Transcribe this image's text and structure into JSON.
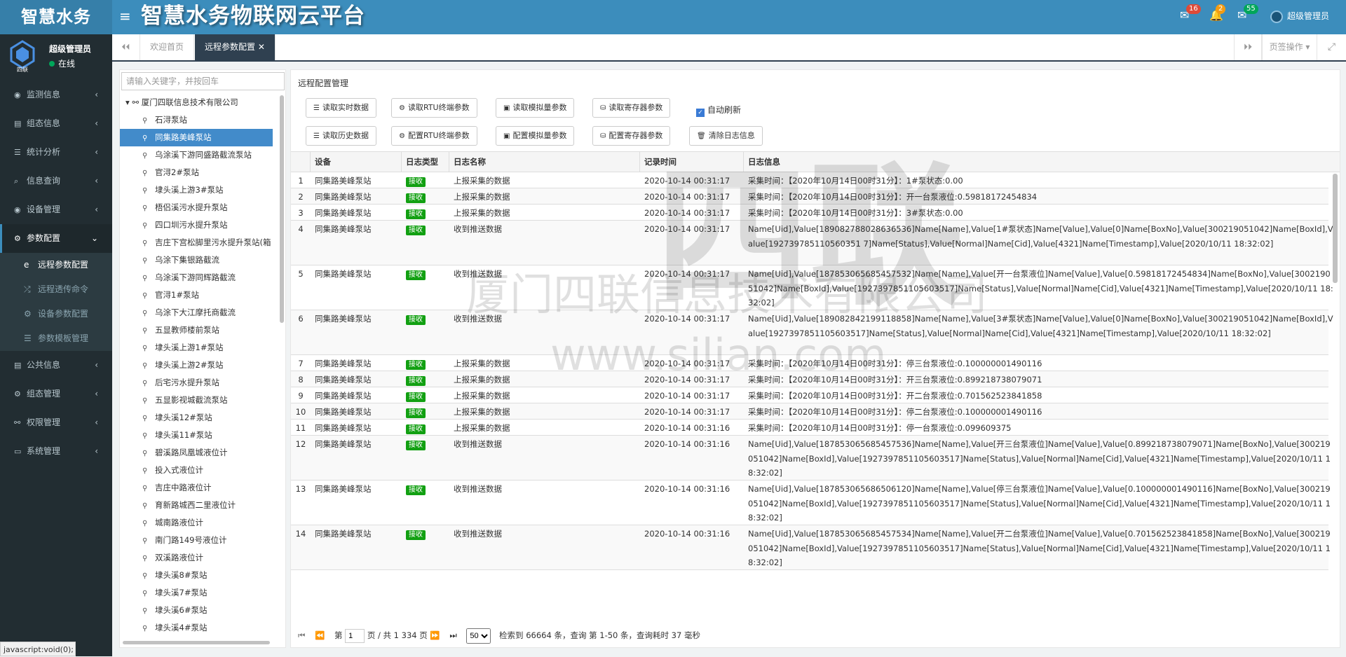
{
  "logo": "智慧水务",
  "system_title": "智慧水务物联网云平台",
  "topbar": {
    "messages_count": "16",
    "notifications_count": "2",
    "tasks_count": "55",
    "user_name": "超级管理员"
  },
  "user_panel": {
    "name": "超级管理员",
    "status": "在线",
    "logo_text": "四联"
  },
  "menu": [
    {
      "label": "监测信息",
      "icon": "dashboard-icon"
    },
    {
      "label": "组态信息",
      "icon": "layout-icon"
    },
    {
      "label": "统计分析",
      "icon": "list-icon"
    },
    {
      "label": "信息查询",
      "icon": "search-icon"
    },
    {
      "label": "设备管理",
      "icon": "dashboard-icon"
    },
    {
      "label": "参数配置",
      "icon": "gears-icon"
    }
  ],
  "submenu": [
    {
      "label": "远程参数配置"
    },
    {
      "label": "远程透传命令"
    },
    {
      "label": "设备参数配置"
    },
    {
      "label": "参数模板管理"
    }
  ],
  "menu2": [
    {
      "label": "公共信息"
    },
    {
      "label": "组态管理"
    },
    {
      "label": "权限管理"
    },
    {
      "label": "系统管理"
    }
  ],
  "tabs": {
    "home": "欢迎首页",
    "active": "远程参数配置",
    "page_ops": "页签操作"
  },
  "tree": {
    "search_placeholder": "请输入关键字，并按回车",
    "root": "厦门四联信息技术有限公司",
    "leaves": [
      "石浔泵站",
      "同集路美峰泵站",
      "乌涂溪下游同盛路截流泵站",
      "官浔2#泵站",
      "埭头溪上游3#泵站",
      "梧侣溪污水提升泵站",
      "四口圳污水提升泵站",
      "吉庄下宫松脚里污水提升泵站(箱",
      "乌涂下集银路截流",
      "乌涂溪下游同辉路截流",
      "官浔1#泵站",
      "乌涂下大江摩托商截流",
      "五显教师楼前泵站",
      "埭头溪上游1#泵站",
      "埭头溪上游2#泵站",
      "后宅污水提升泵站",
      "五显影视城截流泵站",
      "埭头溪12#泵站",
      "埭头溪11#泵站",
      "碧溪路凤凰城液位计",
      "投入式液位计",
      "吉庄中路液位计",
      "育新路城西二里液位计",
      "城南路液位计",
      "南门路149号液位计",
      "双溪路液位计",
      "埭头溪8#泵站",
      "埭头溪7#泵站",
      "埭头溪6#泵站",
      "埭头溪4#泵站"
    ]
  },
  "main": {
    "title": "远程配置管理",
    "buttons_row1": [
      "读取实时数据",
      "读取RTU终端参数",
      "读取模拟量参数",
      "读取寄存器参数"
    ],
    "auto_refresh": "自动刷新",
    "buttons_row2": [
      "读取历史数据",
      "配置RTU终端参数",
      "配置模拟量参数",
      "配置寄存器参数",
      "清除日志信息"
    ],
    "columns": [
      "设备",
      "日志类型",
      "日志名称",
      "记录时间",
      "日志信息"
    ]
  },
  "rows": [
    {
      "no": "1",
      "device": "同集路美峰泵站",
      "type": "接收",
      "name": "上报采集的数据",
      "time": "2020-10-14 00:31:17",
      "info": "采集时间：【2020年10月14日00时31分】：1#泵状态:0.00"
    },
    {
      "no": "2",
      "device": "同集路美峰泵站",
      "type": "接收",
      "name": "上报采集的数据",
      "time": "2020-10-14 00:31:17",
      "info": "采集时间：【2020年10月14日00时31分】：开一台泵液位:0.59818172454834"
    },
    {
      "no": "3",
      "device": "同集路美峰泵站",
      "type": "接收",
      "name": "上报采集的数据",
      "time": "2020-10-14 00:31:17",
      "info": "采集时间：【2020年10月14日00时31分】：3#泵状态:0.00"
    },
    {
      "no": "4",
      "device": "同集路美峰泵站",
      "type": "接收",
      "name": "收到推送数据",
      "time": "2020-10-14 00:31:17",
      "info": "Name[Uid],Value[189082788028636536]Name[Name],Value[1#泵状态]Name[Value],Value[0]Name[BoxNo],Value[300219051042]Name[BoxId],Value[192739785110560351 7]Name[Status],Value[Normal]Name[Cid],Value[4321]Name[Timestamp],Value[2020/10/11 18:32:02]"
    },
    {
      "no": "5",
      "device": "同集路美峰泵站",
      "type": "接收",
      "name": "收到推送数据",
      "time": "2020-10-14 00:31:17",
      "info": "Name[Uid],Value[187853065685457532]Name[Name],Value[开一台泵液位]Name[Value],Value[0.59818172454834]Name[BoxNo],Value[300219051042]Name[BoxId],Value[1927397851105603517]Name[Status],Value[Normal]Name[Cid],Value[4321]Name[Timestamp],Value[2020/10/11 18:32:02]"
    },
    {
      "no": "6",
      "device": "同集路美峰泵站",
      "type": "接收",
      "name": "收到推送数据",
      "time": "2020-10-14 00:31:17",
      "info": "Name[Uid],Value[189082842199118858]Name[Name],Value[3#泵状态]Name[Value],Value[0]Name[BoxNo],Value[300219051042]Name[BoxId],Value[1927397851105603517]Name[Status],Value[Normal]Name[Cid],Value[4321]Name[Timestamp],Value[2020/10/11 18:32:02]"
    },
    {
      "no": "7",
      "device": "同集路美峰泵站",
      "type": "接收",
      "name": "上报采集的数据",
      "time": "2020-10-14 00:31:17",
      "info": "采集时间：【2020年10月14日00时31分】：停三台泵液位:0.100000001490116"
    },
    {
      "no": "8",
      "device": "同集路美峰泵站",
      "type": "接收",
      "name": "上报采集的数据",
      "time": "2020-10-14 00:31:17",
      "info": "采集时间：【2020年10月14日00时31分】：开三台泵液位:0.899218738079071"
    },
    {
      "no": "9",
      "device": "同集路美峰泵站",
      "type": "接收",
      "name": "上报采集的数据",
      "time": "2020-10-14 00:31:17",
      "info": "采集时间：【2020年10月14日00时31分】：开二台泵液位:0.701562523841858"
    },
    {
      "no": "10",
      "device": "同集路美峰泵站",
      "type": "接收",
      "name": "上报采集的数据",
      "time": "2020-10-14 00:31:17",
      "info": "采集时间：【2020年10月14日00时31分】：停二台泵液位:0.100000001490116"
    },
    {
      "no": "11",
      "device": "同集路美峰泵站",
      "type": "接收",
      "name": "上报采集的数据",
      "time": "2020-10-14 00:31:16",
      "info": "采集时间：【2020年10月14日00时31分】：停一台泵液位:0.099609375"
    },
    {
      "no": "12",
      "device": "同集路美峰泵站",
      "type": "接收",
      "name": "收到推送数据",
      "time": "2020-10-14 00:31:16",
      "info": "Name[Uid],Value[187853065685457536]Name[Name],Value[开三台泵液位]Name[Value],Value[0.899218738079071]Name[BoxNo],Value[300219051042]Name[BoxId],Value[1927397851105603517]Name[Status],Value[Normal]Name[Cid],Value[4321]Name[Timestamp],Value[2020/10/11 18:32:02]"
    },
    {
      "no": "13",
      "device": "同集路美峰泵站",
      "type": "接收",
      "name": "收到推送数据",
      "time": "2020-10-14 00:31:16",
      "info": "Name[Uid],Value[187853065686506120]Name[Name],Value[停三台泵液位]Name[Value],Value[0.100000001490116]Name[BoxNo],Value[300219051042]Name[BoxId],Value[1927397851105603517]Name[Status],Value[Normal]Name[Cid],Value[4321]Name[Timestamp],Value[2020/10/11 18:32:02]"
    },
    {
      "no": "14",
      "device": "同集路美峰泵站",
      "type": "接收",
      "name": "收到推送数据",
      "time": "2020-10-14 00:31:16",
      "info": "Name[Uid],Value[187853065685457534]Name[Name],Value[开二台泵液位]Name[Value],Value[0.701562523841858]Name[BoxNo],Value[300219051042]Name[BoxId],Value[1927397851105603517]Name[Status],Value[Normal]Name[Cid],Value[4321]Name[Timestamp],Value[2020/10/11 18:32:02]"
    }
  ],
  "pager": {
    "page_label": "第",
    "page_value": "1",
    "total_text": "页 / 共 1 334 页",
    "page_size": "50",
    "summary": "检索到 66664 条，查询 第 1-50 条，查询耗时 37 毫秒"
  },
  "watermark": {
    "brand": "四联",
    "company": "厦门四联信息技术有限公司",
    "url": "www.silian.com"
  },
  "statusbar": "javascript:void(0);"
}
